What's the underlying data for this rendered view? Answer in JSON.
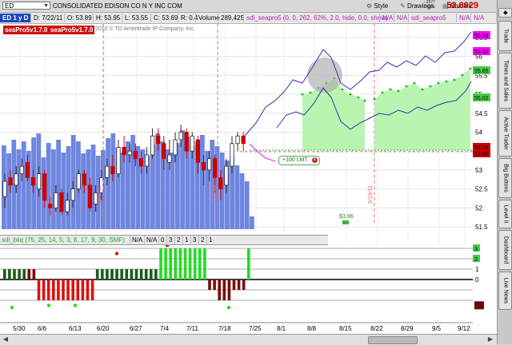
{
  "toolbar": {
    "symbol": "ED",
    "company": "CONSOLIDATED EDISON CO N Y INC COM",
    "style_label": "Style",
    "drawings_label": "Drawings",
    "studies_label": "Studies",
    "last_price": "53.6929",
    "change_line1": "-.2677",
    "change_line2": "-0.49%"
  },
  "infobar": {
    "period": "ED 1 y D",
    "date": "D: 7/22/11",
    "open": "O: 53.89",
    "high": "H: 53.95",
    "low": "L: 53.55",
    "close": "C: 53.69",
    "range": "R: 0.4",
    "volume_label": "Volume",
    "volume_value": "289,425",
    "study_params": "sdi_seapro5 (0, 0, 262, 62%, 2.0, hide, 0.0, show)",
    "na1": "N/A",
    "na2": "N/A",
    "study_short": "sdi_seapro5",
    "na3": "N/A",
    "na4": "N/A"
  },
  "stamps": {
    "left": "seaPro5v1.7.0",
    "right": "seaPro5v1.7.0"
  },
  "copyright": "2010 © TD Ameritrade IP Company, Inc.",
  "order": {
    "label": "+100 LMT",
    "close_icon": "x"
  },
  "lower": {
    "study": "sdi_biiq (75, 25, 14, 5, 3, 8, 17, 9, 30, SMF)",
    "na1": "N/A",
    "na2": "N/A",
    "v1": "0",
    "v2": "3",
    "v3": "2",
    "v4": "1",
    "v5": "3",
    "v6": "2",
    "v7": "1"
  },
  "price_axis": [
    "56.5",
    "56",
    "55.5",
    "55",
    "54.5",
    "54",
    "53.5",
    "53",
    "52.5",
    "52",
    "51.5"
  ],
  "price_tags": [
    {
      "text": "56.56",
      "color": "#ff00ff"
    },
    {
      "text": "56.32",
      "color": "#ff00ff"
    },
    {
      "text": "55.65",
      "color": "#44cc44"
    },
    {
      "text": "55.02",
      "color": "#44cc44"
    },
    {
      "text": "53.78",
      "color": "#cc0000"
    },
    {
      "text": "53.69",
      "color": "#cc0000"
    }
  ],
  "vline_labels": [
    "6/17/11",
    "7/15/11",
    "8/19/11"
  ],
  "small_label": "$3.96",
  "lower_axis": [
    "3",
    "2",
    "1",
    "0"
  ],
  "lower_tags": [
    {
      "text": "3",
      "color": "#44cc44"
    },
    {
      "text": "2",
      "color": "#44cc44"
    }
  ],
  "x_axis": [
    "5/30",
    "6/6",
    "6/13",
    "6/20",
    "6/27",
    "7/4",
    "7/11",
    "7/18",
    "7/25",
    "8/1",
    "8/8",
    "8/15",
    "8/22",
    "8/29",
    "9/5",
    "9/12"
  ],
  "side_tabs": [
    "Trade",
    "Times and Sales",
    "Active Trader",
    "Big Buttons",
    "Level II",
    "Dashboard",
    "Live News"
  ],
  "colors": {
    "volume": "#6f86e0",
    "forecast_fill": "#b9f5b0",
    "up_hist": "#22dd22",
    "down_hist": "#dd1111",
    "dark_up": "#1a5e1a",
    "dark_down": "#7a0a0a",
    "forecast_line": "#3a2fb0",
    "pink_line": "#dd22dd"
  }
}
